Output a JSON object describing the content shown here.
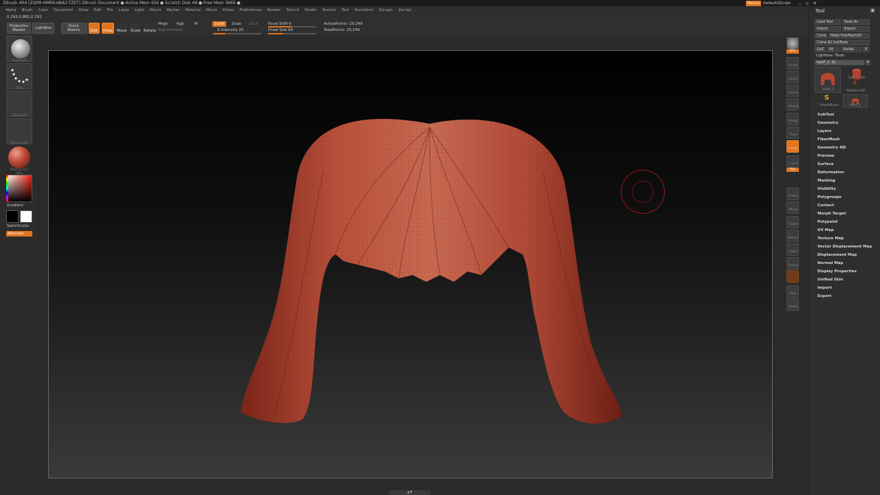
{
  "titlebar": {
    "text": "ZBrush 4R4 [ZQRR-HMRK-ABA3-TZET]   ZBrush Document    ● Active Mem 426 ● Scratch Disk 48 ● Free Mem 3669 ●",
    "menus": "Menus",
    "script": "DefaultZScript"
  },
  "menubar": [
    "Alpha",
    "Brush",
    "Color",
    "Document",
    "Draw",
    "Edit",
    "File",
    "Layer",
    "Light",
    "Macro",
    "Marker",
    "Material",
    "Movie",
    "Picker",
    "Preferences",
    "Render",
    "Stencil",
    "Stroke",
    "Texture",
    "Tool",
    "Transform",
    "Zplugin",
    "Zscript"
  ],
  "toolbar": {
    "coords": "0.292,0.861,0.291",
    "projection_master": "Projection Master",
    "lightbox": "LightBox",
    "quick_sketch": "Quick Sketch",
    "edit": "Edit",
    "draw": "Draw",
    "move": "Move",
    "scale": "Scale",
    "rotate": "Rotate",
    "mrgb": "Mrgb",
    "rgb": "Rgb",
    "m": "M",
    "rgb_intensity": "Rgb Intensity",
    "zadd": "Zadd",
    "zsub": "Zsub",
    "zcut": "Zcut",
    "z_intensity": "Z Intensity 25",
    "focal_shift": "Focal Shift 0",
    "draw_size": "Draw Size 64",
    "active_points": "ActivePoints: 20,249",
    "total_points": "TotalPoints: 20,249",
    "z_intensity_value": 25,
    "draw_size_value": 64
  },
  "leftshelf": {
    "brush": "Standard",
    "stroke": "Dots",
    "alpha": "Alpha Off",
    "texture": "Texture Off",
    "material": "MatCap Red Wax",
    "gradient": "Gradient",
    "switch_color": "SwitchColor",
    "alternate": "Alternate"
  },
  "rightshelf": {
    "items": [
      "BPR",
      "Scroll",
      "Zoom",
      "Actual",
      "AAHalf",
      "Persp",
      "Floor",
      "Local",
      "L.Sym",
      "Frame",
      "Move",
      "Scale",
      "Rotate",
      "PolyF",
      "Transp",
      "Solo",
      "Xpose"
    ],
    "spix": "SPix",
    "xyz": "Xyz"
  },
  "toolpanel": {
    "title": "Tool",
    "load_tool": "Load Tool",
    "save_as": "Save As",
    "import": "Import",
    "export": "Export",
    "clone": "Clone",
    "make_polymesh": "Make PolyMesh3D",
    "clone_all": "Clone All SubTools",
    "goz": "GoZ",
    "all": "All",
    "visible": "Visible",
    "r": "R",
    "lightbox_tools": "Lightbox› Tools",
    "current_tool": "hairF_2. 41",
    "thumbs": [
      "hairF_2",
      "Cylinder3D",
      "PolyMesh3D",
      "SimpleBrush",
      "hairF_2"
    ],
    "sections": [
      "SubTool",
      "Geometry",
      "Layers",
      "FiberMesh",
      "Geometry HD",
      "Preview",
      "Surface",
      "Deformation",
      "Masking",
      "Visibility",
      "Polygroups",
      "Contact",
      "Morph Target",
      "Polypaint",
      "UV Map",
      "Texture Map",
      "Vector Displacement Map",
      "Displacement Map",
      "Normal Map",
      "Display Properties",
      "Unified Skin",
      "Import",
      "Export"
    ]
  },
  "colors": {
    "accent": "#e2741d",
    "hair": "#b44530",
    "cursor": "#a01616"
  }
}
